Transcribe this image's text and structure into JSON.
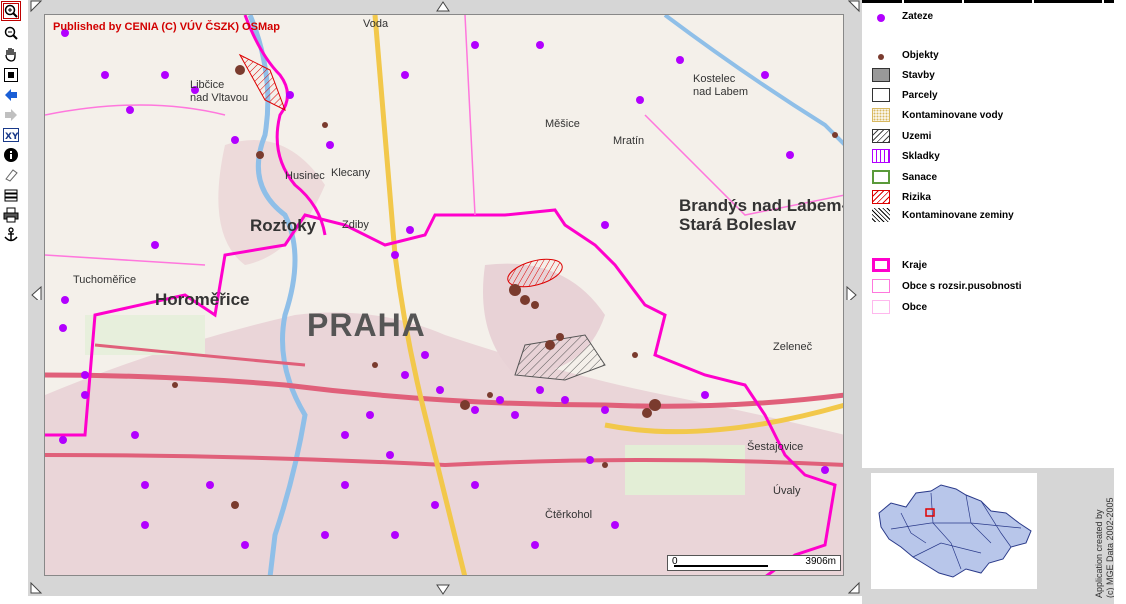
{
  "toolbar": {
    "tools": [
      {
        "name": "zoom-in-tool",
        "glyph": "⊕",
        "active": true
      },
      {
        "name": "zoom-out-tool",
        "glyph": "🔍",
        "active": false
      },
      {
        "name": "pan-hand-tool",
        "glyph": "✋",
        "active": false
      },
      {
        "name": "full-extent-tool",
        "glyph": "▣",
        "active": false
      },
      {
        "name": "back-tool",
        "glyph": "⬅",
        "active": false
      },
      {
        "name": "forward-tool",
        "glyph": "➡",
        "active": false
      },
      {
        "name": "xy-coordinates-tool",
        "glyph": "XY",
        "active": false
      },
      {
        "name": "info-tool",
        "glyph": "ℹ",
        "active": false
      },
      {
        "name": "clear-tool",
        "glyph": "⌫",
        "active": false
      },
      {
        "name": "select-tool",
        "glyph": "⊞",
        "active": false
      },
      {
        "name": "print-tool",
        "glyph": "🖶",
        "active": false
      },
      {
        "name": "anchor-tool",
        "glyph": "⚓",
        "active": false
      }
    ]
  },
  "map": {
    "copyright": "Published by CENIA   (C) VÚV ČSZK) OSMap",
    "scale": {
      "zero": "0",
      "distance": "3906m"
    },
    "places": [
      {
        "text": "Voda",
        "cls": ""
      },
      {
        "text": "Libčice",
        "cls": ""
      },
      {
        "text": "nad Vltavou",
        "cls": ""
      },
      {
        "text": "Roztoky",
        "cls": "big"
      },
      {
        "text": "Horoměřice",
        "cls": "big"
      },
      {
        "text": "PRAHA",
        "cls": "huge"
      },
      {
        "text": "Kostelec",
        "cls": ""
      },
      {
        "text": "nad Labem",
        "cls": ""
      },
      {
        "text": "Brandýs nad Labem-",
        "cls": "big"
      },
      {
        "text": "Stará Boleslav",
        "cls": "big"
      },
      {
        "text": "Klecany",
        "cls": ""
      },
      {
        "text": "Zdiby",
        "cls": ""
      },
      {
        "text": "Husinec",
        "cls": ""
      },
      {
        "text": "Tuchoměřice",
        "cls": ""
      },
      {
        "text": "Zeleneč",
        "cls": ""
      },
      {
        "text": "Šestajovice",
        "cls": ""
      },
      {
        "text": "Čtěrkohol",
        "cls": ""
      },
      {
        "text": "Mratín",
        "cls": ""
      },
      {
        "text": "Měšice",
        "cls": ""
      },
      {
        "text": "Úvaly",
        "cls": ""
      }
    ]
  },
  "legend": {
    "items": [
      {
        "label": "Zateze",
        "sym": "purple-dot"
      },
      {
        "label": "Objekty",
        "sym": "brown-dot"
      },
      {
        "label": "Stavby",
        "sym": "grey-box"
      },
      {
        "label": "Parcely",
        "sym": "white-box"
      },
      {
        "label": "Kontaminovane vody",
        "sym": "dotted-box"
      },
      {
        "label": "Uzemi",
        "sym": "hatched-box"
      },
      {
        "label": "Skladky",
        "sym": "purple-lines-box"
      },
      {
        "label": "Sanace",
        "sym": "green-box"
      },
      {
        "label": "Rizika",
        "sym": "red-hatch-box"
      },
      {
        "label": "Kontaminovane zeminy",
        "sym": "black-hatch-box"
      },
      {
        "label": "Kraje",
        "sym": "magenta-thick-box"
      },
      {
        "label": "Obce s rozsir.pusobnosti",
        "sym": "pink-box"
      },
      {
        "label": "Obce",
        "sym": "light-pink-box"
      }
    ]
  },
  "credits": {
    "line1": "Application created by",
    "line2": "(c) MGE Data 2002-2005"
  },
  "colors": {
    "accent": "#d20000",
    "zateze": "#b200ff",
    "objekty": "#7a3b2e",
    "kraje": "#ff00cc",
    "roads": "#e0607a",
    "water": "#8fbfe8"
  }
}
